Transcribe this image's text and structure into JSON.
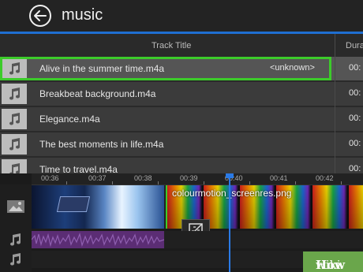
{
  "header": {
    "title": "music",
    "back_icon": "back-arrow-icon"
  },
  "list": {
    "columns": {
      "title": "Track Title",
      "duration": "Dura"
    },
    "rows": [
      {
        "name": "Alive in the summer time.m4a",
        "artist": "<unknown>",
        "duration": "00:"
      },
      {
        "name": "Breakbeat background.m4a",
        "artist": "",
        "duration": "00:"
      },
      {
        "name": "Elegance.m4a",
        "artist": "",
        "duration": "00:"
      },
      {
        "name": "The best moments in life.m4a",
        "artist": "",
        "duration": "00:"
      },
      {
        "name": "Time to travel.m4a",
        "artist": "",
        "duration": "00:"
      }
    ],
    "selected_index": 0
  },
  "timeline": {
    "ticks": [
      "00:36",
      "00:37",
      "00:38",
      "00:39",
      "00:40",
      "00:41",
      "00:42"
    ],
    "video_clip_label": "colourmotion_screenres.png"
  },
  "watermark": {
    "part1": "wiki",
    "part2": "How"
  },
  "colors": {
    "accent": "#1f6fd1",
    "selection": "#3ccb2a",
    "audio": "#5b2d74",
    "playhead": "#2a7ae6"
  }
}
